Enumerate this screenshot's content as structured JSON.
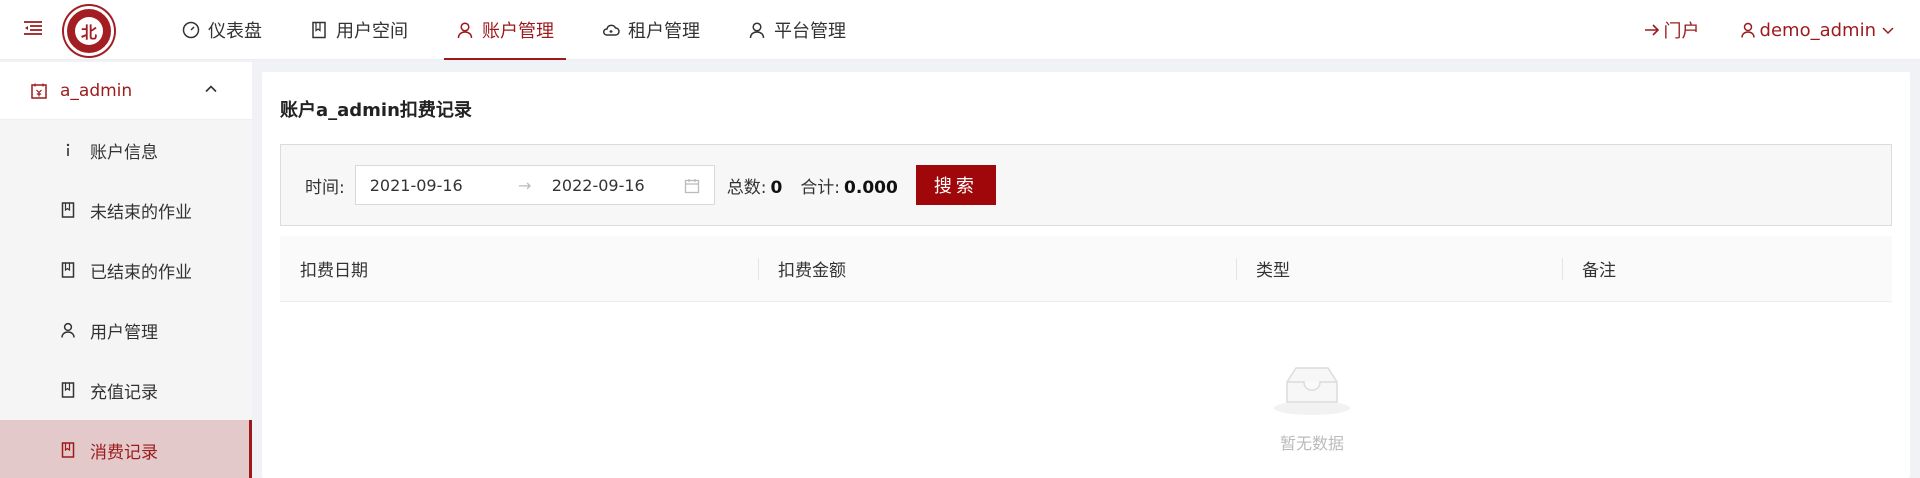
{
  "header": {
    "nav": [
      {
        "label": "仪表盘",
        "icon": "dashboard-icon",
        "active": false
      },
      {
        "label": "用户空间",
        "icon": "book-icon",
        "active": false
      },
      {
        "label": "账户管理",
        "icon": "user-icon",
        "active": true
      },
      {
        "label": "租户管理",
        "icon": "cloud-icon",
        "active": false
      },
      {
        "label": "平台管理",
        "icon": "user-icon",
        "active": false
      }
    ],
    "portal_label": "门户",
    "user_label": "demo_admin"
  },
  "sidebar": {
    "group_label": "a_admin",
    "items": [
      {
        "label": "账户信息",
        "icon": "info-icon"
      },
      {
        "label": "未结束的作业",
        "icon": "book-icon"
      },
      {
        "label": "已结束的作业",
        "icon": "book-icon"
      },
      {
        "label": "用户管理",
        "icon": "user-icon"
      },
      {
        "label": "充值记录",
        "icon": "book-icon"
      },
      {
        "label": "消费记录",
        "icon": "book-icon",
        "active": true
      }
    ]
  },
  "main": {
    "title": "账户a_admin扣费记录",
    "filter": {
      "time_label": "时间:",
      "start_date": "2021-09-16",
      "end_date": "2022-09-16",
      "arrow": "→",
      "total_count_label": "总数:",
      "total_count": "0",
      "sum_label": "合计:",
      "sum": "0.000",
      "search_label": "搜索"
    },
    "table": {
      "columns": [
        "扣费日期",
        "扣费金额",
        "类型",
        "备注"
      ]
    },
    "empty_text": "暂无数据"
  },
  "colors": {
    "accent": "#9c1a1c",
    "button": "#a0070b",
    "active_bg": "#e3c9c9"
  }
}
